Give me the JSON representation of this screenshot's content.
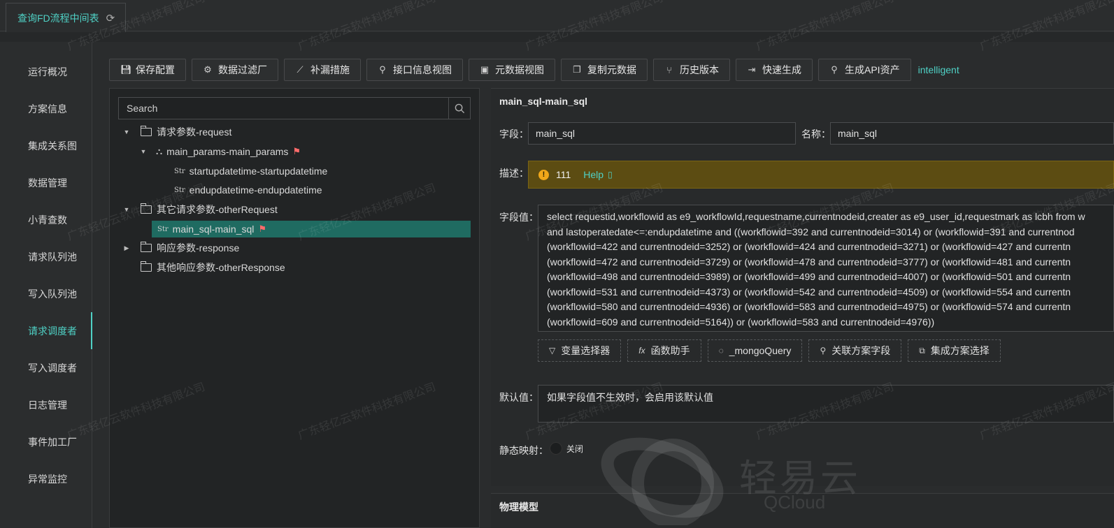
{
  "tab": {
    "label": "查询FD流程中间表"
  },
  "sidenav": {
    "items": [
      {
        "label": "运行概况"
      },
      {
        "label": "方案信息"
      },
      {
        "label": "集成关系图"
      },
      {
        "label": "数据管理"
      },
      {
        "label": "小青查数"
      },
      {
        "label": "请求队列池"
      },
      {
        "label": "写入队列池"
      },
      {
        "label": "请求调度者"
      },
      {
        "label": "写入调度者"
      },
      {
        "label": "日志管理"
      },
      {
        "label": "事件加工厂"
      },
      {
        "label": "异常监控"
      }
    ],
    "active": "请求调度者"
  },
  "toolbar": {
    "buttons": [
      {
        "label": "保存配置",
        "icon": "save-icon"
      },
      {
        "label": "数据过滤厂",
        "icon": "gear-icon"
      },
      {
        "label": "补漏措施",
        "icon": "chart-line-icon"
      },
      {
        "label": "接口信息视图",
        "icon": "link-icon"
      },
      {
        "label": "元数据视图",
        "icon": "code-icon"
      },
      {
        "label": "复制元数据",
        "icon": "copy-icon"
      },
      {
        "label": "历史版本",
        "icon": "branch-icon"
      },
      {
        "label": "快速生成",
        "icon": "export-icon"
      },
      {
        "label": "生成API资产",
        "icon": "link-icon"
      }
    ],
    "link": "intelligent"
  },
  "tree": {
    "search_placeholder": "Search",
    "nodes": [
      {
        "label": "请求参数-request"
      },
      {
        "label": "main_params-main_params"
      },
      {
        "label": "startupdatetime-startupdatetime",
        "type": "Str"
      },
      {
        "label": "endupdatetime-endupdatetime",
        "type": "Str"
      },
      {
        "label": "其它请求参数-otherRequest"
      },
      {
        "label": "main_sql-main_sql",
        "type": "Str"
      },
      {
        "label": "响应参数-response"
      },
      {
        "label": "其他响应参数-otherResponse"
      }
    ]
  },
  "form": {
    "title": "main_sql-main_sql",
    "field_label": "字段：",
    "field_value": "main_sql",
    "name_label": "名称：",
    "name_value": "main_sql",
    "desc_label": "描述：",
    "desc_value": "111",
    "help_label": "Help",
    "value_label": "字段值：",
    "sql_lines": [
      "select requestid,workflowid as e9_workflowId,requestname,currentnodeid,creater as e9_user_id,requestmark as lcbh from w",
      "and lastoperatedate<=:endupdatetime and ((workflowid=392 and currentnodeid=3014) or (workflowid=391 and currentnod",
      "(workflowid=422 and currentnodeid=3252) or (workflowid=424 and currentnodeid=3271) or (workflowid=427 and currentn",
      "(workflowid=472 and currentnodeid=3729) or (workflowid=478 and currentnodeid=3777) or (workflowid=481 and currentn",
      "(workflowid=498 and currentnodeid=3989) or (workflowid=499 and currentnodeid=4007) or (workflowid=501 and currentn",
      "(workflowid=531 and currentnodeid=4373) or (workflowid=542 and currentnodeid=4509) or (workflowid=554 and currentn",
      "(workflowid=580 and currentnodeid=4936) or (workflowid=583 and currentnodeid=4975) or (workflowid=574 and currentn",
      "(workflowid=609 and currentnodeid=5164)) or (workflowid=583 and currentnodeid=4976))"
    ],
    "value_buttons": [
      {
        "label": "变量选择器",
        "icon": "filter-icon"
      },
      {
        "label": "函数助手",
        "icon": "fx-icon"
      },
      {
        "label": "_mongoQuery",
        "icon": "bulb-icon"
      },
      {
        "label": "关联方案字段",
        "icon": "link-icon"
      },
      {
        "label": "集成方案选择",
        "icon": "blocks-icon"
      }
    ],
    "default_label": "默认值：",
    "default_placeholder": "如果字段值不生效时，会启用该默认值",
    "static_label": "静态映射：",
    "static_toggle": "关闭"
  },
  "bottom_section": {
    "title": "物理模型"
  },
  "watermark": "广东轻亿云软件科技有限公司",
  "logo": {
    "cn": "轻易云",
    "en": "QCloud"
  }
}
